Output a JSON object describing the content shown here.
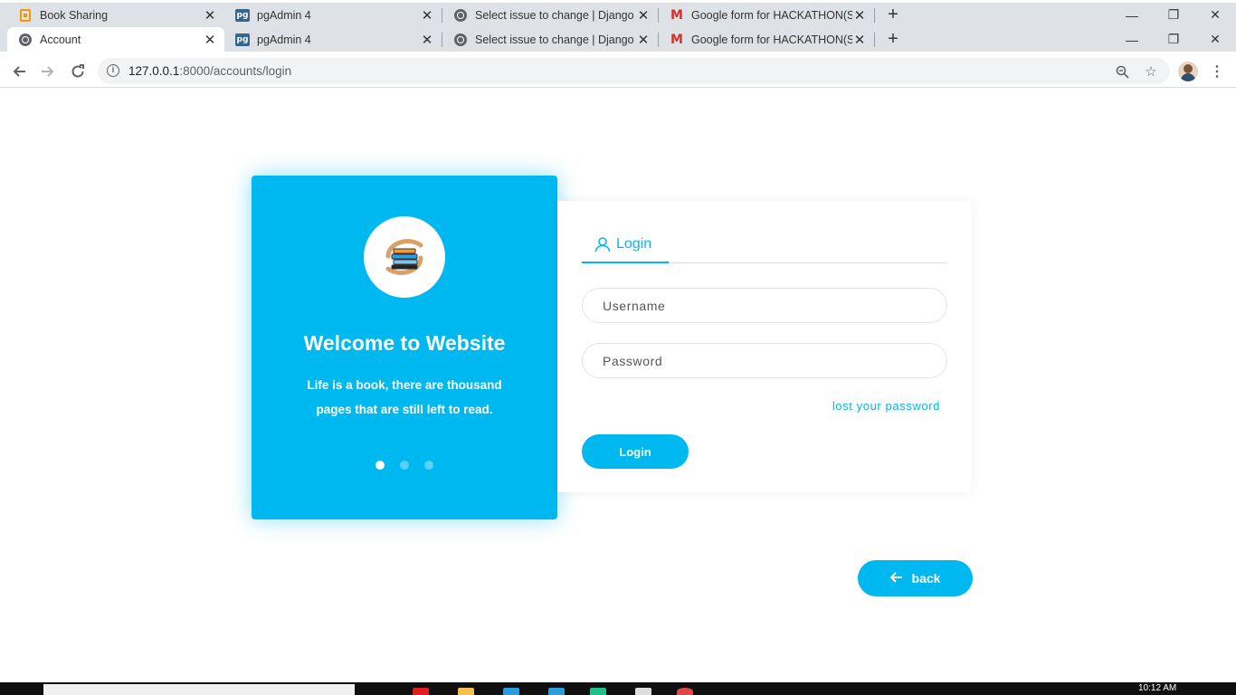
{
  "browser": {
    "tabs_row1": [
      {
        "title": "Book Sharing",
        "icon": "book-icon",
        "active": false
      },
      {
        "title": "pgAdmin 4",
        "icon": "pg-icon",
        "active": false
      },
      {
        "title": "Select issue to change | Django s",
        "icon": "globe-icon",
        "active": false
      },
      {
        "title": "Google form for HACKATHON(SS",
        "icon": "gmail-icon",
        "active": false
      }
    ],
    "tabs_row2": [
      {
        "title": "Account",
        "icon": "globe-icon",
        "active": true
      },
      {
        "title": "pgAdmin 4",
        "icon": "pg-icon",
        "active": false
      },
      {
        "title": "Select issue to change | Django s",
        "icon": "globe-icon",
        "active": false
      },
      {
        "title": "Google form for HACKATHON(SS",
        "icon": "gmail-icon",
        "active": false
      }
    ],
    "url_host": "127.0.0.1",
    "url_path": ":8000/accounts/login"
  },
  "welcome_panel": {
    "title": "Welcome to Website",
    "quote": "Life is a book, there are thousand pages that are still left to read.",
    "slide_count": 3,
    "active_slide": 1
  },
  "login_form": {
    "tab_label": "Login",
    "username_placeholder": "Username",
    "password_placeholder": "Password",
    "lost_password": "lost your password",
    "submit_label": "Login"
  },
  "back_button": {
    "label": "back"
  },
  "taskbar": {
    "clock": "10:12 AM"
  },
  "colors": {
    "accent": "#00b8f0",
    "chrome_bg": "#dee1e6"
  }
}
